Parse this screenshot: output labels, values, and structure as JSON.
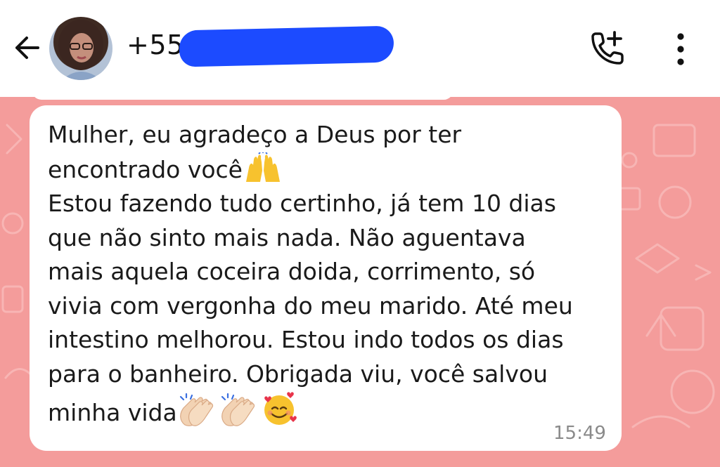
{
  "header": {
    "contact_name": "+55 ",
    "icons": {
      "back": "arrow-left-icon",
      "call": "add-call-icon",
      "menu": "more-vertical-icon"
    }
  },
  "message": {
    "lines": [
      "Mulher, eu agradeço a Deus por ter",
      "encontrado você",
      "Estou fazendo tudo certinho, já tem 10 dias",
      "que não sinto mais nada. Não aguentava",
      "mais aquela coceira doida, corrimento, só",
      "vivia com vergonha do meu marido. Até meu",
      "intestino melhorou. Estou indo todos os dias",
      "para o banheiro. Obrigada viu, você salvou",
      "minha vida"
    ],
    "emojis": {
      "line2": "raising-hands-emoji",
      "line9": [
        "clapping-hands-emoji",
        "clapping-hands-emoji",
        "smiling-face-with-hearts-emoji"
      ]
    },
    "time": "15:49"
  },
  "colors": {
    "header_bg": "#ffffff",
    "chat_bg": "#f49c9b",
    "bubble_bg": "#ffffff",
    "redaction": "#1c4bff",
    "text": "#1a1a1a",
    "time": "#8a8a8a"
  }
}
